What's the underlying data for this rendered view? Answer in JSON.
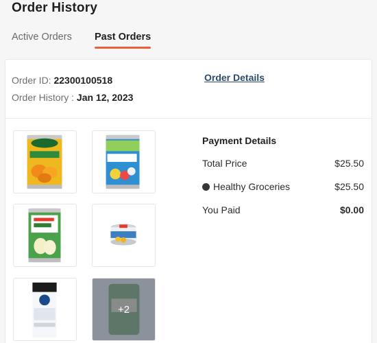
{
  "header": {
    "title": "Order History"
  },
  "tabs": [
    {
      "label": "Active Orders",
      "active": false
    },
    {
      "label": "Past Orders",
      "active": true
    }
  ],
  "order": {
    "id_label": "Order ID:",
    "id_value": "22300100518",
    "date_label": "Order History :",
    "date_value": "Jan 12, 2023",
    "details_link": "Order Details",
    "more_items": "+2"
  },
  "payment": {
    "title": "Payment Details",
    "total_label": "Total Price",
    "total_value": "$25.50",
    "method_label": "Healthy Groceries",
    "method_value": "$25.50",
    "paid_label": "You Paid",
    "paid_value": "$0.00"
  },
  "colors": {
    "tab_accent": "#e8603c",
    "link": "#2a4a6e",
    "method_dot": "#333a33"
  }
}
